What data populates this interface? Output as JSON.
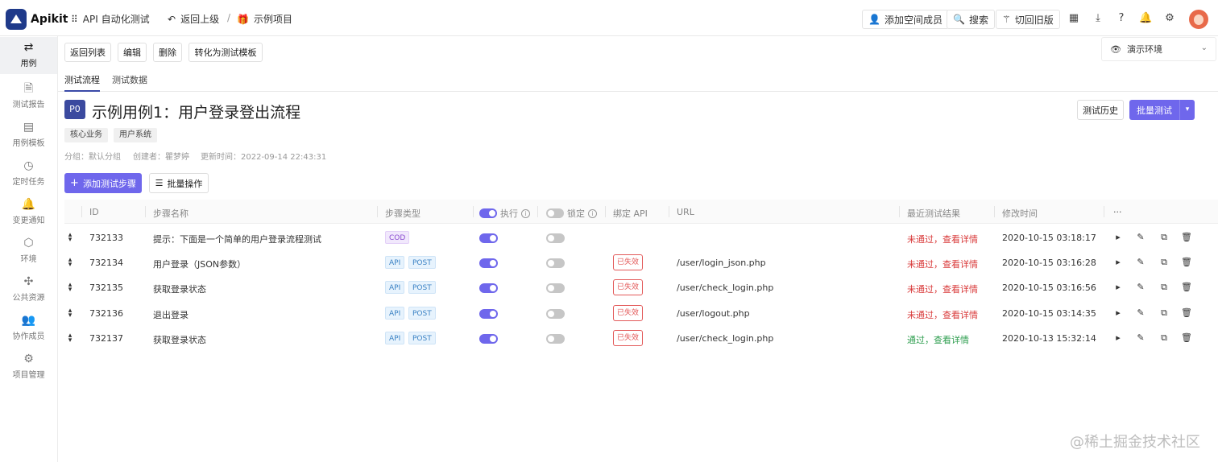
{
  "app": {
    "name": "Apikit"
  },
  "topbar": {
    "module": "API 自动化测试",
    "back": "返回上级",
    "separator": "/",
    "project": "示例项目",
    "add_member": "添加空间成员",
    "search": "搜索",
    "old_version": "切回旧版"
  },
  "sidebar": {
    "items": [
      {
        "label": "用例",
        "icon": "swap-icon"
      },
      {
        "label": "测试报告",
        "icon": "report-icon"
      },
      {
        "label": "用例模板",
        "icon": "template-icon"
      },
      {
        "label": "定时任务",
        "icon": "timer-icon"
      },
      {
        "label": "变更通知",
        "icon": "bell-icon"
      },
      {
        "label": "环境",
        "icon": "cube-icon"
      },
      {
        "label": "公共资源",
        "icon": "puzzle-icon"
      },
      {
        "label": "协作成员",
        "icon": "users-icon"
      },
      {
        "label": "项目管理",
        "icon": "gear-icon"
      }
    ]
  },
  "toolbar": {
    "back_list": "返回列表",
    "edit": "编辑",
    "delete": "删除",
    "to_template": "转化为测试模板"
  },
  "env": {
    "label": "演示环境"
  },
  "tabs": [
    "测试流程",
    "测试数据"
  ],
  "case": {
    "priority": "P0",
    "title": "示例用例1：用户登录登出流程",
    "tags": [
      "核心业务",
      "用户系统"
    ],
    "group": "分组：默认分组",
    "creator": "创建者：瞿梦婷",
    "updated": "更新时间：2022-09-14 22:43:31",
    "history": "测试历史",
    "batch_test": "批量测试",
    "add_step": "添加测试步骤",
    "batch_op": "批量操作"
  },
  "table": {
    "headers": {
      "id": "ID",
      "name": "步骤名称",
      "type": "步骤类型",
      "exec": "执行",
      "lock": "锁定",
      "bind": "绑定 API",
      "url": "URL",
      "result": "最近测试结果",
      "time": "修改时间",
      "more": "···"
    },
    "rows": [
      {
        "id": "732133",
        "name": "提示：下面是一个简单的用户登录流程测试",
        "type": [
          "COD"
        ],
        "bind": "",
        "url": "",
        "result": "未通过，查看详情",
        "status": "fail",
        "time": "2020-10-15 03:18:17"
      },
      {
        "id": "732134",
        "name": "用户登录（JSON参数）",
        "type": [
          "API",
          "POST"
        ],
        "bind": "已失效",
        "url": "/user/login_json.php",
        "result": "未通过，查看详情",
        "status": "fail",
        "time": "2020-10-15 03:16:28"
      },
      {
        "id": "732135",
        "name": "获取登录状态",
        "type": [
          "API",
          "POST"
        ],
        "bind": "已失效",
        "url": "/user/check_login.php",
        "result": "未通过，查看详情",
        "status": "fail",
        "time": "2020-10-15 03:16:56"
      },
      {
        "id": "732136",
        "name": "退出登录",
        "type": [
          "API",
          "POST"
        ],
        "bind": "已失效",
        "url": "/user/logout.php",
        "result": "未通过，查看详情",
        "status": "fail",
        "time": "2020-10-15 03:14:35"
      },
      {
        "id": "732137",
        "name": "获取登录状态",
        "type": [
          "API",
          "POST"
        ],
        "bind": "已失效",
        "url": "/user/check_login.php",
        "result": "通过，查看详情",
        "status": "pass",
        "time": "2020-10-13 15:32:14"
      }
    ]
  },
  "watermark": "@稀土掘金技术社区",
  "colors": {
    "accent": "#6f67ec",
    "brand": "#1f3a8a",
    "fail": "#d93a3a",
    "pass": "#2e9e4f"
  }
}
